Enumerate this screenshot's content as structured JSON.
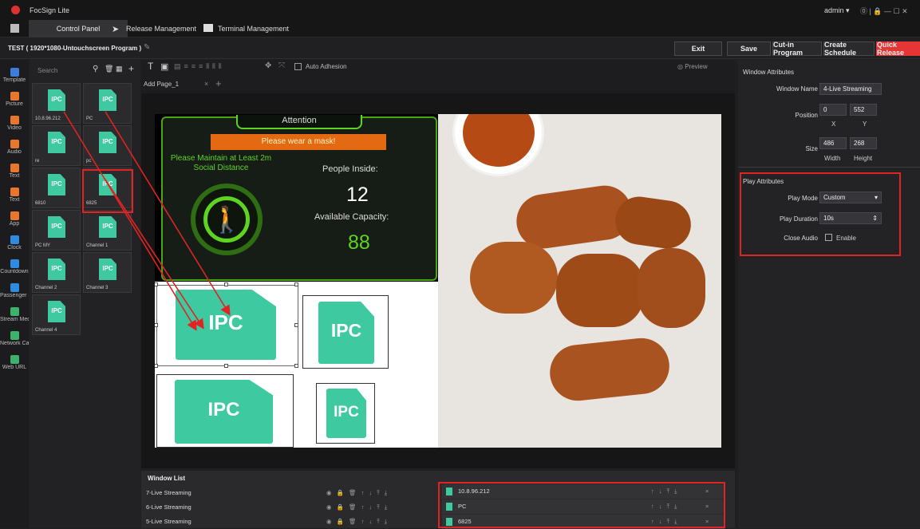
{
  "app": {
    "title": "FocSign Lite",
    "user": "admin",
    "window_controls": "⓪ | 🔒 — ☐ ✕"
  },
  "tabs": [
    {
      "label": "Control Panel"
    },
    {
      "label": "Release Management"
    },
    {
      "label": "Terminal Management"
    }
  ],
  "program": {
    "title": "TEST ( 1920*1080-Untouchscreen Program )",
    "buttons": {
      "exit": "Exit",
      "save": "Save",
      "cutin": "Cut-in Program",
      "schedule": "Create Schedule",
      "quick": "Quick Release"
    }
  },
  "leftbar": [
    {
      "label": "Template",
      "color": "#3d7fd8"
    },
    {
      "label": "Picture",
      "color": "#e8772e"
    },
    {
      "label": "Video",
      "color": "#e8772e"
    },
    {
      "label": "Audio",
      "color": "#e8772e"
    },
    {
      "label": "Text",
      "color": "#e8772e"
    },
    {
      "label": "Text",
      "color": "#e8772e"
    },
    {
      "label": "App",
      "color": "#e8772e"
    },
    {
      "label": "Clock",
      "color": "#2f8be0"
    },
    {
      "label": "Countdown",
      "color": "#2f8be0"
    },
    {
      "label": "Passenger Fl",
      "color": "#2f8be0"
    },
    {
      "label": "Stream Med",
      "color": "#3cb26a"
    },
    {
      "label": "Network Camera",
      "color": "#3cb26a"
    },
    {
      "label": "Web URL",
      "color": "#3cb26a"
    }
  ],
  "media": {
    "search_placeholder": "Search",
    "tiles": [
      {
        "label": "10.8.96.212"
      },
      {
        "label": "PC"
      },
      {
        "label": "re"
      },
      {
        "label": "pc"
      },
      {
        "label": "6810"
      },
      {
        "label": "6825"
      },
      {
        "label": "PC MY"
      },
      {
        "label": "Channel 1"
      },
      {
        "label": "Channel 2"
      },
      {
        "label": "Channel 3"
      },
      {
        "label": "Channel 4"
      }
    ],
    "icon_text": "IPC"
  },
  "editor": {
    "auto_adhesion": "Auto Adhesion",
    "preview": "Preview",
    "page_tab": "Add Page_1",
    "close": "×",
    "add": "+"
  },
  "canvas": {
    "attention": "Attention",
    "mask": "Please wear a mask!",
    "distance": "Please Maintain at Least 2m Social Distance",
    "people_label": "People Inside:",
    "people_value": "12",
    "capacity_label": "Available Capacity:",
    "capacity_value": "88",
    "ipc": "IPC",
    "colors": {
      "green": "#5fd420",
      "orange": "#e36a12"
    }
  },
  "window_list": {
    "title": "Window List",
    "rows": [
      {
        "name": "7-Live Streaming"
      },
      {
        "name": "6-Live Streaming"
      },
      {
        "name": "5-Live Streaming"
      }
    ],
    "streams": [
      {
        "name": "10.8.96.212"
      },
      {
        "name": "PC"
      },
      {
        "name": "6825"
      }
    ],
    "icons": "◉ 🔒 🗑  ↑ ↓ ⤒ ⤓",
    "stream_icons": "↑ ↓ ⤒ ⤓",
    "remove": "×"
  },
  "window_attrs": {
    "title": "Window Attributes",
    "name_label": "Window Name",
    "name_value": "4-Live Streaming",
    "position_label": "Position",
    "x": "0",
    "y": "552",
    "x_label": "X",
    "y_label": "Y",
    "size_label": "Size",
    "w": "486",
    "h": "268",
    "w_label": "Width",
    "h_label": "Height"
  },
  "play_attrs": {
    "title": "Play Attributes",
    "mode_label": "Play Mode",
    "mode_value": "Custom",
    "duration_label": "Play Duration",
    "duration_value": "10s",
    "audio_label": "Close Audio",
    "audio_enable": "Enable"
  }
}
